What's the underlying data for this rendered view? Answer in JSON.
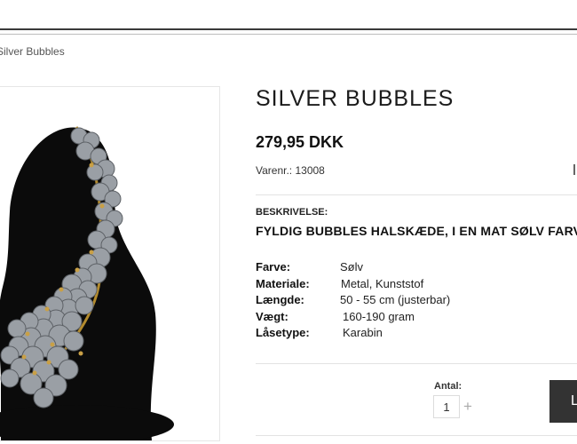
{
  "breadcrumb": {
    "current": "Silver Bubbles"
  },
  "product": {
    "title": "SILVER BUBBLES",
    "price": "279,95 DKK",
    "sku": "Varenr.: 13008",
    "image_alt": "necklace-on-black-bust",
    "description_label": "BESKRIVELSE:",
    "description": "FYLDIG BUBBLES HALSKÆDE, I EN MAT SØLV FARVE.",
    "specs": [
      {
        "label": "Farve:",
        "value": "Sølv"
      },
      {
        "label": "Materiale:",
        "value": "Metal, Kunststof"
      },
      {
        "label": "Længde:",
        "value": "50 - 55 cm (justerbar)"
      },
      {
        "label": "Vægt:",
        "value": "160-190 gram"
      },
      {
        "label": "Låsetype:",
        "value": "Karabin"
      }
    ]
  },
  "cart": {
    "qty_label": "Antal:",
    "qty_value": "1",
    "plus_symbol": "+",
    "buy_label": "L"
  },
  "colors": {
    "button_bg": "#333333",
    "divider": "#e3e3e3"
  }
}
